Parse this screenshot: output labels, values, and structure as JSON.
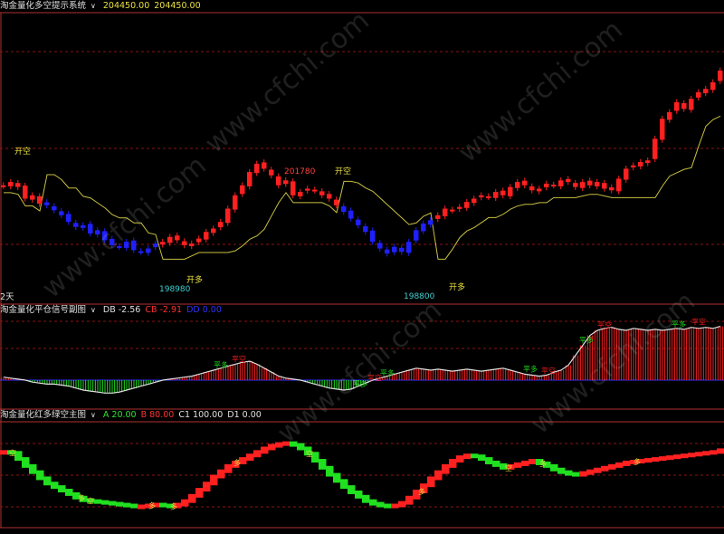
{
  "header_main": {
    "title": "淘金量化多空提示系统",
    "v1": "204450.00",
    "v2": "204450.00"
  },
  "header_sub1": {
    "title": "淘金量化平仓信号副图",
    "db": "DB -2.56",
    "cb": "CB -2.91",
    "dd": "DD 0.00"
  },
  "header_sub2": {
    "title": "淘金量化红多绿空主图",
    "a": "A 20.00",
    "b": "B 80.00",
    "c1": "C1 100.00",
    "d1": "D1 0.00"
  },
  "watermark": "www.cfchi.com",
  "period_label": "2天",
  "colors": {
    "up": "#ff2020",
    "down": "#2020ff",
    "band": "#c8c040",
    "green": "#20e020",
    "red": "#ff2020",
    "grid": "#8a1515",
    "axis_line": "#b03030"
  },
  "chart_data": [
    {
      "type": "candlestick",
      "panel": "main",
      "ylim": [
        198000,
        204450
      ],
      "annotations": [
        {
          "text": "开空",
          "kind": "signal"
        },
        {
          "text": "201780",
          "kind": "high"
        },
        {
          "text": "开空",
          "kind": "signal"
        },
        {
          "text": "198980",
          "kind": "low"
        },
        {
          "text": "开多",
          "kind": "signal"
        },
        {
          "text": "198800",
          "kind": "low"
        },
        {
          "text": "开多",
          "kind": "signal"
        }
      ],
      "series": [
        {
          "values": [
            201000,
            201100,
            200950,
            200600,
            200700,
            200450,
            200400,
            200250,
            200100,
            199900,
            199750,
            199800,
            199550,
            199650,
            199350,
            199200,
            199150,
            199300,
            199050,
            199000,
            199100,
            199250,
            199300,
            199450,
            199350,
            199200,
            199250,
            199400,
            199600,
            199700,
            199900,
            200300,
            200700,
            201000,
            201400,
            201650,
            201500,
            201300,
            201000,
            201150,
            200700,
            200800,
            200900,
            200850,
            200700,
            200600,
            200400,
            200200,
            200000,
            199800,
            199600,
            199300,
            199100,
            198950,
            199150,
            199000,
            199300,
            199650,
            199850,
            199950,
            200100,
            200300,
            200250,
            200350,
            200500,
            200600,
            200700,
            200650,
            200800,
            200700,
            200950,
            201100,
            201000,
            200850,
            200900,
            201050,
            201000,
            201150,
            201100,
            200950,
            201100,
            201000,
            201100,
            200900,
            200850,
            201200,
            201500,
            201600,
            201700,
            201750,
            202400,
            203000,
            203200,
            203500,
            203300,
            203600,
            203800,
            203900,
            204100,
            204450
          ]
        }
      ]
    },
    {
      "type": "bar",
      "panel": "sub1",
      "markers": [
        "平多",
        "平空"
      ],
      "series": [
        {
          "values": [
            0.3,
            0.2,
            0.1,
            0.0,
            -0.2,
            -0.3,
            -0.4,
            -0.4,
            -0.5,
            -0.6,
            -0.8,
            -1.0,
            -1.1,
            -1.2,
            -1.3,
            -1.3,
            -1.2,
            -1.0,
            -0.8,
            -0.6,
            -0.4,
            -0.2,
            0.0,
            0.1,
            0.2,
            0.3,
            0.4,
            0.6,
            0.8,
            1.0,
            1.2,
            1.4,
            1.6,
            1.8,
            1.9,
            1.6,
            1.2,
            0.8,
            0.4,
            0.2,
            0.1,
            0.0,
            -0.2,
            -0.4,
            -0.6,
            -0.8,
            -0.9,
            -1.0,
            -0.9,
            -0.6,
            -0.3,
            0.0,
            0.2,
            0.4,
            0.6,
            0.8,
            1.0,
            1.2,
            1.1,
            1.0,
            1.1,
            1.0,
            0.9,
            1.0,
            1.1,
            1.0,
            0.9,
            1.0,
            1.1,
            1.2,
            1.0,
            0.8,
            0.6,
            0.5,
            0.4,
            0.5,
            0.8,
            1.0,
            1.5,
            2.5,
            3.5,
            4.5,
            5.0,
            5.2,
            5.3,
            5.1,
            5.0,
            5.2,
            5.1,
            5.0,
            5.1,
            5.0,
            5.1,
            5.2,
            5.1,
            5.3,
            5.2,
            5.3,
            5.2,
            5.4
          ]
        }
      ]
    },
    {
      "type": "bar",
      "panel": "sub2",
      "markers": [
        "多",
        "空"
      ],
      "ylim": [
        0,
        100
      ],
      "series": [
        {
          "values": [
            78,
            77,
            70,
            62,
            55,
            48,
            42,
            38,
            34,
            30,
            26,
            23,
            22,
            21,
            20,
            19,
            18,
            17,
            16,
            16,
            17,
            18,
            17,
            16,
            18,
            22,
            28,
            35,
            42,
            50,
            56,
            62,
            66,
            70,
            74,
            78,
            82,
            85,
            87,
            88,
            86,
            82,
            76,
            68,
            60,
            52,
            45,
            38,
            32,
            27,
            22,
            19,
            17,
            16,
            17,
            20,
            26,
            33,
            40,
            48,
            55,
            62,
            68,
            72,
            74,
            73,
            70,
            66,
            63,
            60,
            62,
            64,
            66,
            68,
            65,
            62,
            58,
            55,
            53,
            52,
            54,
            56,
            58,
            60,
            62,
            64,
            66,
            67,
            68,
            69,
            70,
            71,
            72,
            73,
            74,
            75,
            76,
            77,
            78,
            80
          ]
        }
      ]
    }
  ]
}
